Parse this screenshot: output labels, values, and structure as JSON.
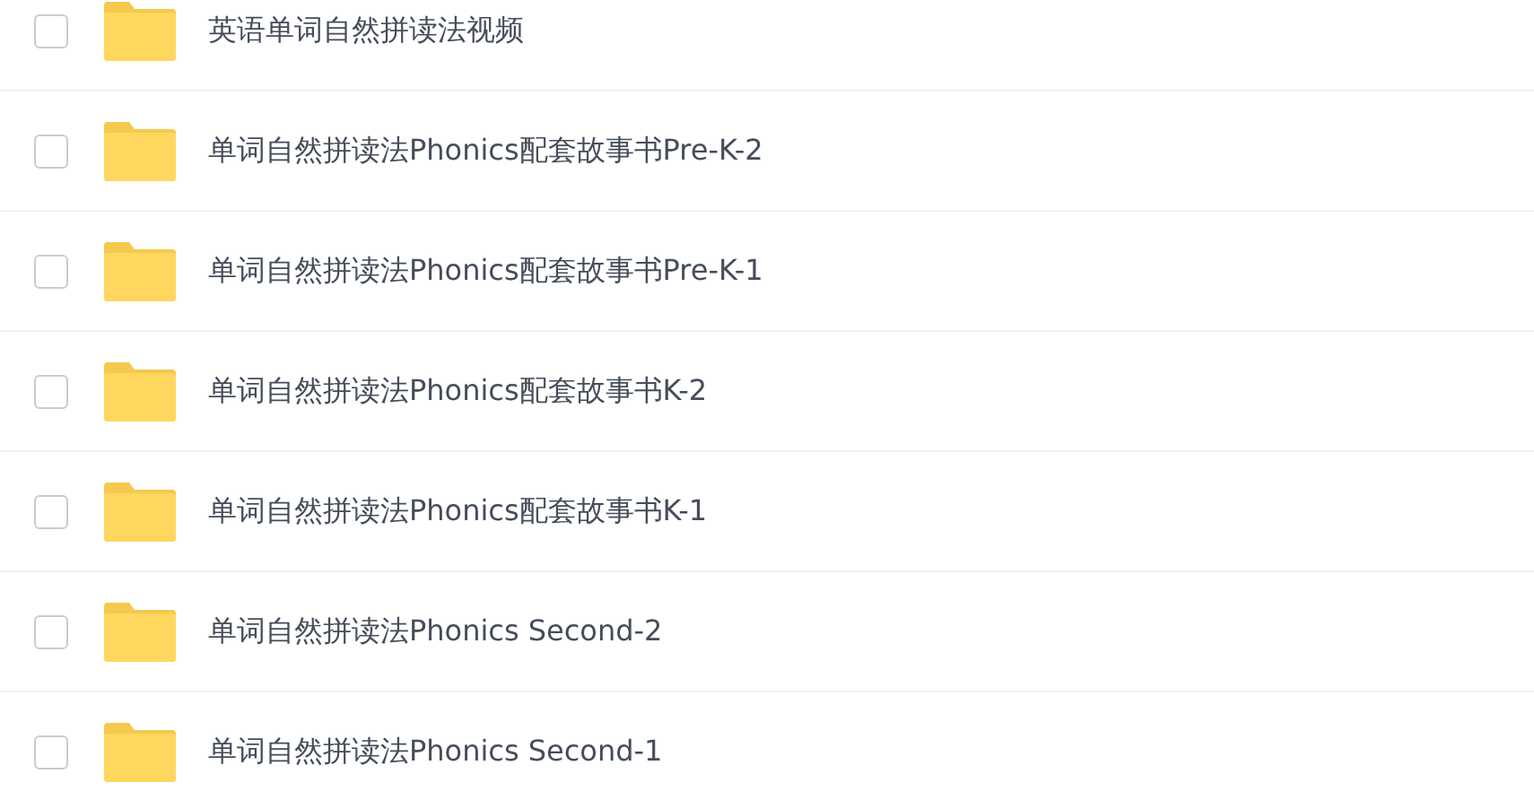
{
  "files": [
    {
      "name": "英语单词自然拼读法视频",
      "checked": false
    },
    {
      "name": "单词自然拼读法Phonics配套故事书Pre-K-2",
      "checked": false
    },
    {
      "name": "单词自然拼读法Phonics配套故事书Pre-K-1",
      "checked": false
    },
    {
      "name": "单词自然拼读法Phonics配套故事书K-2",
      "checked": false
    },
    {
      "name": "单词自然拼读法Phonics配套故事书K-1",
      "checked": false
    },
    {
      "name": "单词自然拼读法Phonics Second-2",
      "checked": false
    },
    {
      "name": "单词自然拼读法Phonics Second-1",
      "checked": false
    }
  ]
}
